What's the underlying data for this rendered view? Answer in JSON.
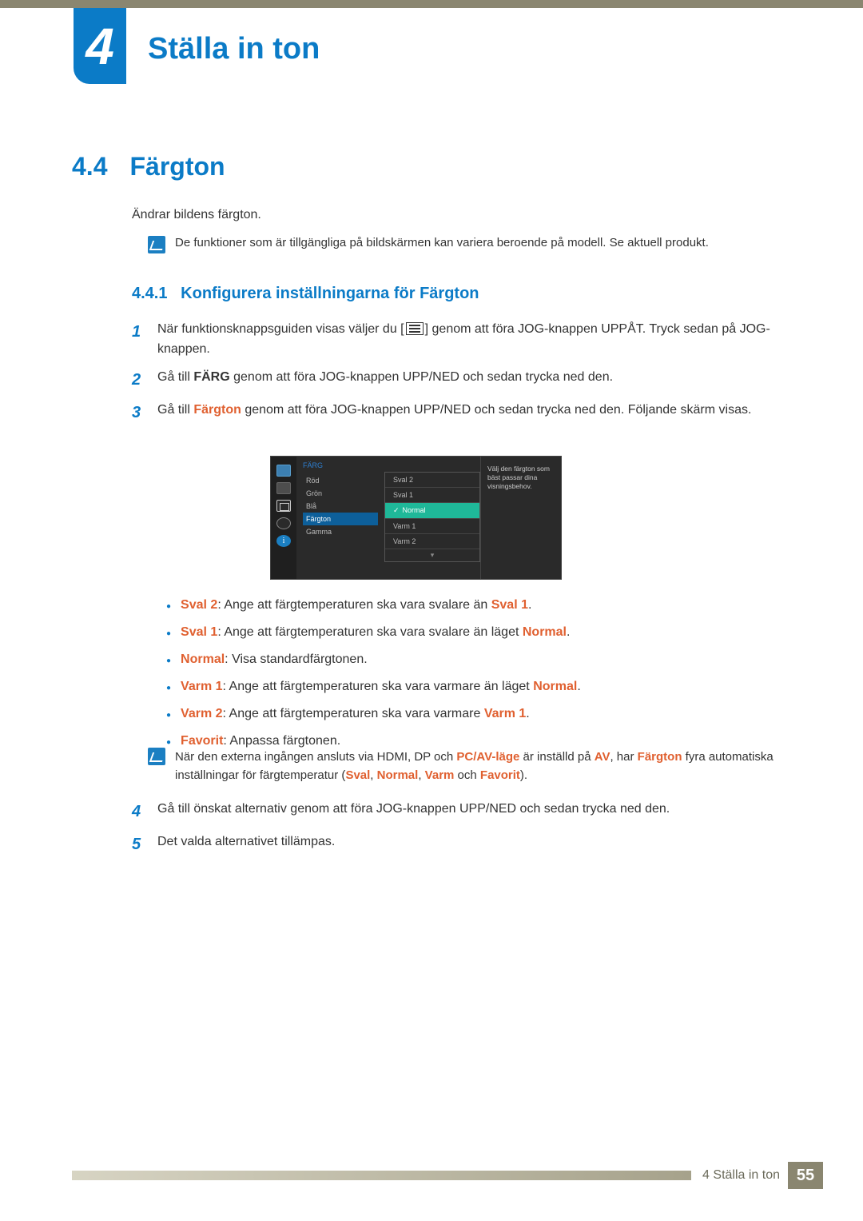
{
  "chapter": {
    "number": "4",
    "title": "Ställa in ton"
  },
  "section": {
    "number": "4.4",
    "title": "Färgton"
  },
  "intro": "Ändrar bildens färgton.",
  "note1": "De funktioner som är tillgängliga på bildskärmen kan variera beroende på modell. Se aktuell produkt.",
  "subsection": {
    "number": "4.4.1",
    "title": "Konfigurera inställningarna för Färgton"
  },
  "steps": {
    "s1a": "När funktionsknappsguiden visas väljer du [",
    "s1b": "] genom att föra JOG-knappen UPPÅT. Tryck sedan på JOG-knappen.",
    "s2a": "Gå till ",
    "s2_color": "FÄRG",
    "s2b": " genom att föra JOG-knappen UPP/NED och sedan trycka ned den.",
    "s3a": "Gå till ",
    "s3_color": "Färgton",
    "s3b": " genom att föra JOG-knappen UPP/NED och sedan trycka ned den. Följande skärm visas.",
    "s4": "Gå till önskat alternativ genom att föra JOG-knappen UPP/NED och sedan trycka ned den.",
    "s5": "Det valda alternativet tillämpas."
  },
  "osd": {
    "title": "FÄRG",
    "left_items": [
      "Röd",
      "Grön",
      "Blå",
      "Färgton",
      "Gamma"
    ],
    "sub_items": [
      "Sval 2",
      "Sval 1",
      "Normal",
      "Varm 1",
      "Varm 2"
    ],
    "help": "Välj den färgton som bäst passar dina visningsbehov."
  },
  "bullets": {
    "b1_k": "Sval 2",
    "b1_t": ": Ange att färgtemperaturen ska vara svalare än ",
    "b1_k2": "Sval 1",
    "b1_end": ".",
    "b2_k": "Sval 1",
    "b2_t": ": Ange att färgtemperaturen ska vara svalare än läget ",
    "b2_k2": "Normal",
    "b2_end": ".",
    "b3_k": "Normal",
    "b3_t": ": Visa standardfärgtonen.",
    "b4_k": "Varm 1",
    "b4_t": ": Ange att färgtemperaturen ska vara varmare än läget ",
    "b4_k2": "Normal",
    "b4_end": ".",
    "b5_k": "Varm 2",
    "b5_t": ": Ange att färgtemperaturen ska vara varmare ",
    "b5_k2": "Varm 1",
    "b5_end": ".",
    "b6_k": "Favorit",
    "b6_t": ": Anpassa färgtonen."
  },
  "note2": {
    "t1": "När den externa ingången ansluts via HDMI, DP och ",
    "k1": "PC/AV-läge",
    "t2": " är inställd på ",
    "k2": "AV",
    "t3": ", har ",
    "k3": "Färgton",
    "t4": " fyra automatiska inställningar för färgtemperatur (",
    "k4": "Sval",
    "c1": ", ",
    "k5": "Normal",
    "c2": ", ",
    "k6": "Varm",
    "t5": " och ",
    "k7": "Favorit",
    "t6": ")."
  },
  "footer": {
    "label": "4 Ställa in ton",
    "page": "55"
  }
}
